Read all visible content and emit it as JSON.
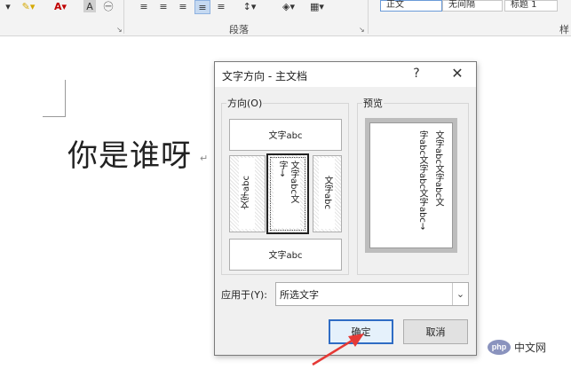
{
  "ribbon": {
    "paragraph_group_label": "段落",
    "style_label": "样",
    "styles": [
      "正文",
      "无间隔",
      "标题 1"
    ],
    "icons": [
      "font-color-dropdown-icon",
      "highlight-icon",
      "font-color-icon",
      "char-shading-icon",
      "enclose-char-icon",
      "align-left-icon",
      "align-center-icon",
      "align-right-icon",
      "justify-icon",
      "distributed-icon",
      "line-spacing-icon",
      "shading-icon",
      "borders-icon"
    ]
  },
  "document": {
    "text": "你是谁呀",
    "para_mark": "↵"
  },
  "dialog": {
    "title": "文字方向 - 主文档",
    "help": "?",
    "close": "✕",
    "direction_group": "方向(O)",
    "preview_group": "预览",
    "options": {
      "horizontal": "文字abc",
      "rotate_left": "文字abc",
      "vertical_stacked_col1": "文字abc文",
      "vertical_stacked_col2": "字→",
      "rotate_right": "文字abc",
      "horizontal_flipped": "文字abc"
    },
    "preview_lines": [
      "文字abc文字abc文",
      "字abc文字abc文字abc→"
    ],
    "apply_to_label": "应用于(Y):",
    "apply_to_value": "所选文字",
    "ok": "确定",
    "cancel": "取消",
    "selected_option": "vertical-stacked"
  },
  "watermark": {
    "logo": "php",
    "text": "中文网"
  },
  "colors": {
    "ok_border": "#2f6cc4",
    "arrow": "#e53935"
  }
}
